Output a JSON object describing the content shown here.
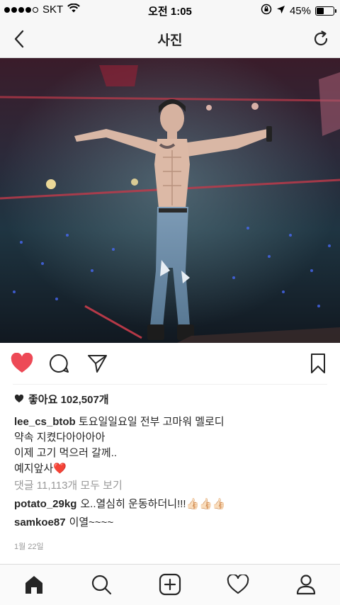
{
  "status_bar": {
    "carrier": "SKT",
    "time": "오전 1:05",
    "battery_percent": "45%",
    "battery_level": 0.45
  },
  "nav": {
    "title": "사진",
    "back_icon": "chevron-left-icon",
    "refresh_icon": "refresh-icon"
  },
  "post": {
    "liked": true,
    "like_color": "#ed4956",
    "likes_text": "좋아요 102,507개",
    "caption": {
      "username": "lee_cs_btob",
      "lines": [
        "토요일일요일 전부 고마워 멜로디",
        "약속 지켰다아아아아",
        "이제 고기 먹으러 갈께..",
        "예지앞사❤️"
      ]
    },
    "view_comments": "댓글 11,113개 모두 보기",
    "comments": [
      {
        "username": "potato_29kg",
        "text": "오..열심히 운동하더니!!!👍🏻👍🏻👍🏻"
      },
      {
        "username": "samkoe87",
        "text": "이열~~~~"
      }
    ],
    "date": "1월 22일"
  },
  "actions": [
    "heart-icon",
    "comment-icon",
    "share-icon",
    "bookmark-icon"
  ],
  "tabs": [
    "home-icon",
    "search-icon",
    "add-icon",
    "activity-icon",
    "profile-icon"
  ]
}
